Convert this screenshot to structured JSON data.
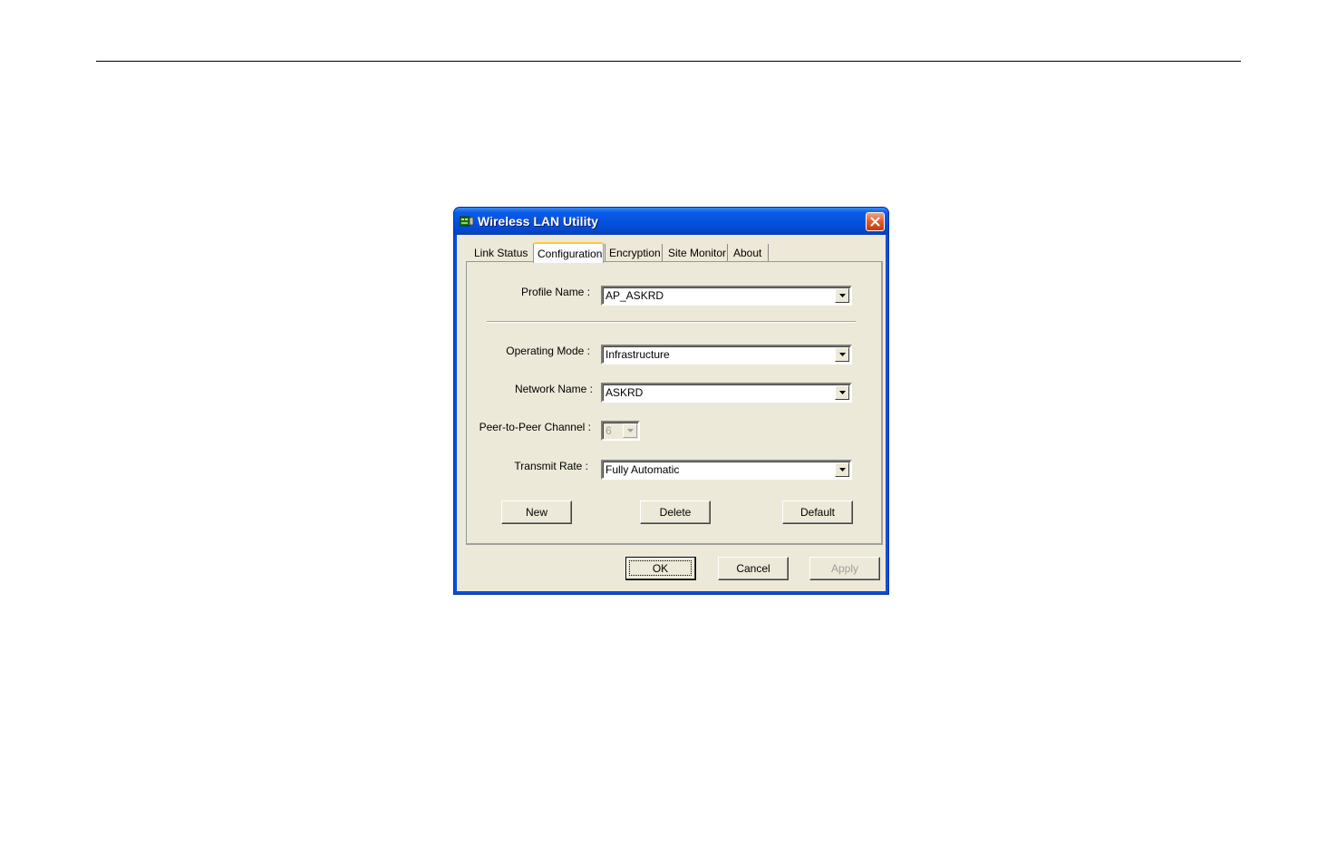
{
  "window": {
    "title": "Wireless LAN Utility",
    "close_icon": "close-x-icon",
    "app_icon": "network-card-icon"
  },
  "tabs": [
    {
      "label": "Link Status"
    },
    {
      "label": "Configuration",
      "active": true
    },
    {
      "label": "Encryption"
    },
    {
      "label": "Site Monitor"
    },
    {
      "label": "About"
    }
  ],
  "config": {
    "profile_name_label": "Profile Name :",
    "profile_name_value": "AP_ASKRD",
    "operating_mode_label": "Operating Mode :",
    "operating_mode_value": "Infrastructure",
    "network_name_label": "Network Name :",
    "network_name_value": "ASKRD",
    "channel_label": "Peer-to-Peer Channel :",
    "channel_value": "6",
    "transmit_rate_label": "Transmit Rate :",
    "transmit_rate_value": "Fully Automatic"
  },
  "buttons": {
    "new": "New",
    "delete": "Delete",
    "default": "Default",
    "ok": "OK",
    "cancel": "Cancel",
    "apply": "Apply"
  },
  "colors": {
    "titlebar": "#0451dd",
    "window_bg": "#ece9d8",
    "active_tab_accent": "#ffc83c",
    "close_button": "#e25a2a"
  }
}
